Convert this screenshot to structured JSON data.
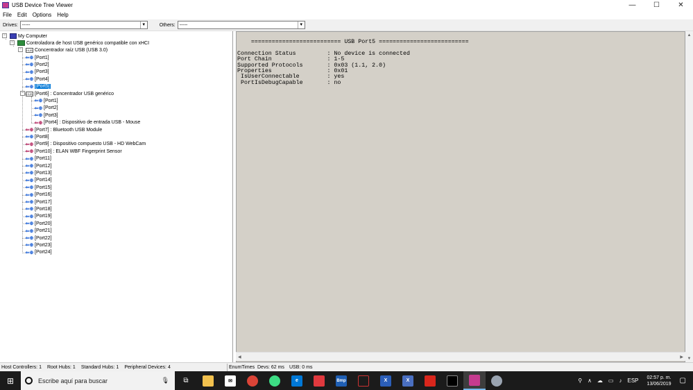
{
  "window": {
    "title": "USB Device Tree Viewer",
    "controls": {
      "minimize": "—",
      "maximize": "☐",
      "close": "✕"
    }
  },
  "menu": [
    "File",
    "Edit",
    "Options",
    "Help"
  ],
  "toolbar": {
    "drives_label": "Drives:",
    "drives_value": "-----",
    "others_label": "Others:",
    "others_value": "-----"
  },
  "tree": {
    "root": "My Computer",
    "controller": "Controladora de host USB genérico compatible con xHCI",
    "root_hub": "Concentrador raíz USB (USB 3.0)",
    "root_ports": [
      "[Port1]",
      "[Port2]",
      "[Port3]",
      "[Port4]",
      "[Port5]",
      "[Port6] : Concentrador USB genérico",
      "[Port7] : Bluetooth USB Module",
      "[Port8]",
      "[Port9] : Dispositivo compuesto USB - HD WebCam",
      "[Port10] : ELAN WBF Fingerprint Sensor",
      "[Port11]",
      "[Port12]",
      "[Port13]",
      "[Port14]",
      "[Port15]",
      "[Port16]",
      "[Port17]",
      "[Port18]",
      "[Port19]",
      "[Port20]",
      "[Port21]",
      "[Port22]",
      "[Port23]",
      "[Port24]"
    ],
    "sub_ports": [
      "[Port1]",
      "[Port2]",
      "[Port3]",
      "[Port4] : Dispositivo de entrada USB - Mouse"
    ]
  },
  "detail": {
    "header": "    ========================== USB Port5 ==========================",
    "rows": [
      {
        "key": "Connection Status",
        "value": "No device is connected"
      },
      {
        "key": "Port Chain",
        "value": "1-5"
      },
      {
        "key": "Supported Protocols",
        "value": "0x03 (1.1, 2.0)"
      },
      {
        "key": "Properties",
        "value": "0x01"
      },
      {
        "key": " IsUserConnectable",
        "value": "yes"
      },
      {
        "key": " PortIsDebugCapable",
        "value": "no"
      }
    ]
  },
  "status": {
    "host_controllers": "Host Controllers: 1",
    "root_hubs": "Root Hubs: 1",
    "standard_hubs": "Standard Hubs: 1",
    "peripheral_devices": "Peripheral Devices: 4",
    "enum_times": "EnumTimes",
    "devs": "Devs: 62 ms",
    "usb": "USB: 0 ms"
  },
  "taskbar": {
    "search_placeholder": "Escribe aquí para buscar",
    "language": "ESP",
    "time": "02:57 p. m.",
    "date": "13/06/2019"
  }
}
